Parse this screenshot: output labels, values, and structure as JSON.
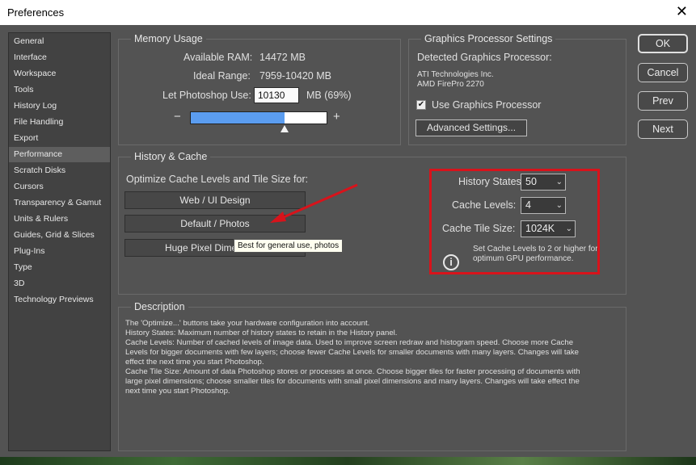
{
  "window": {
    "title": "Preferences"
  },
  "sidebar": {
    "items": [
      {
        "label": "General"
      },
      {
        "label": "Interface"
      },
      {
        "label": "Workspace"
      },
      {
        "label": "Tools"
      },
      {
        "label": "History Log"
      },
      {
        "label": "File Handling"
      },
      {
        "label": "Export"
      },
      {
        "label": "Performance"
      },
      {
        "label": "Scratch Disks"
      },
      {
        "label": "Cursors"
      },
      {
        "label": "Transparency & Gamut"
      },
      {
        "label": "Units & Rulers"
      },
      {
        "label": "Guides, Grid & Slices"
      },
      {
        "label": "Plug-Ins"
      },
      {
        "label": "Type"
      },
      {
        "label": "3D"
      },
      {
        "label": "Technology Previews"
      }
    ],
    "selected": "Performance"
  },
  "memory": {
    "title": "Memory Usage",
    "available_label": "Available RAM:",
    "available_value": "14472 MB",
    "ideal_label": "Ideal Range:",
    "ideal_value": "7959-10420 MB",
    "let_label": "Let Photoshop Use:",
    "let_value": "10130",
    "let_unit": "MB (69%)",
    "minus": "−",
    "plus": "+",
    "slider_fraction": 0.69
  },
  "gpu": {
    "title": "Graphics Processor Settings",
    "detected_label": "Detected Graphics Processor:",
    "vendor": "ATI Technologies Inc.",
    "model": "AMD FirePro 2270",
    "use_gpu_label": "Use Graphics Processor",
    "use_gpu_checked": true,
    "advanced_label": "Advanced Settings..."
  },
  "history_cache": {
    "title": "History & Cache",
    "optimize_label": "Optimize Cache Levels and Tile Size for:",
    "buttons": [
      "Web / UI Design",
      "Default / Photos",
      "Huge Pixel Dimensions"
    ],
    "history_states_label": "History States:",
    "history_states_value": "50",
    "cache_levels_label": "Cache Levels:",
    "cache_levels_value": "4",
    "tile_size_label": "Cache Tile Size:",
    "tile_size_value": "1024K",
    "gpu_note_line1": "Set Cache Levels to 2 or higher for",
    "gpu_note_line2": "optimum GPU performance."
  },
  "tooltip": "Best for general use, photos",
  "description": {
    "title": "Description",
    "lines": [
      "The 'Optimize...' buttons take your hardware configuration into account.",
      "History States: Maximum number of history states to retain in the History panel.",
      "Cache Levels: Number of cached levels of image data.  Used to improve screen redraw and histogram speed.  Choose more Cache",
      "Levels for bigger documents with few layers; choose fewer Cache Levels for smaller documents with many layers. Changes will take",
      "effect the next time you start Photoshop.",
      "Cache Tile Size: Amount of data Photoshop stores or processes at once. Choose bigger tiles for faster processing of documents with",
      "large pixel dimensions; choose smaller tiles for documents with small pixel dimensions and many layers. Changes will take effect the",
      "next time you start Photoshop."
    ]
  },
  "dialog_buttons": {
    "ok": "OK",
    "cancel": "Cancel",
    "prev": "Prev",
    "next": "Next"
  },
  "colors": {
    "annotation_red": "#d8131b",
    "slider_fill": "#5b9df0"
  }
}
